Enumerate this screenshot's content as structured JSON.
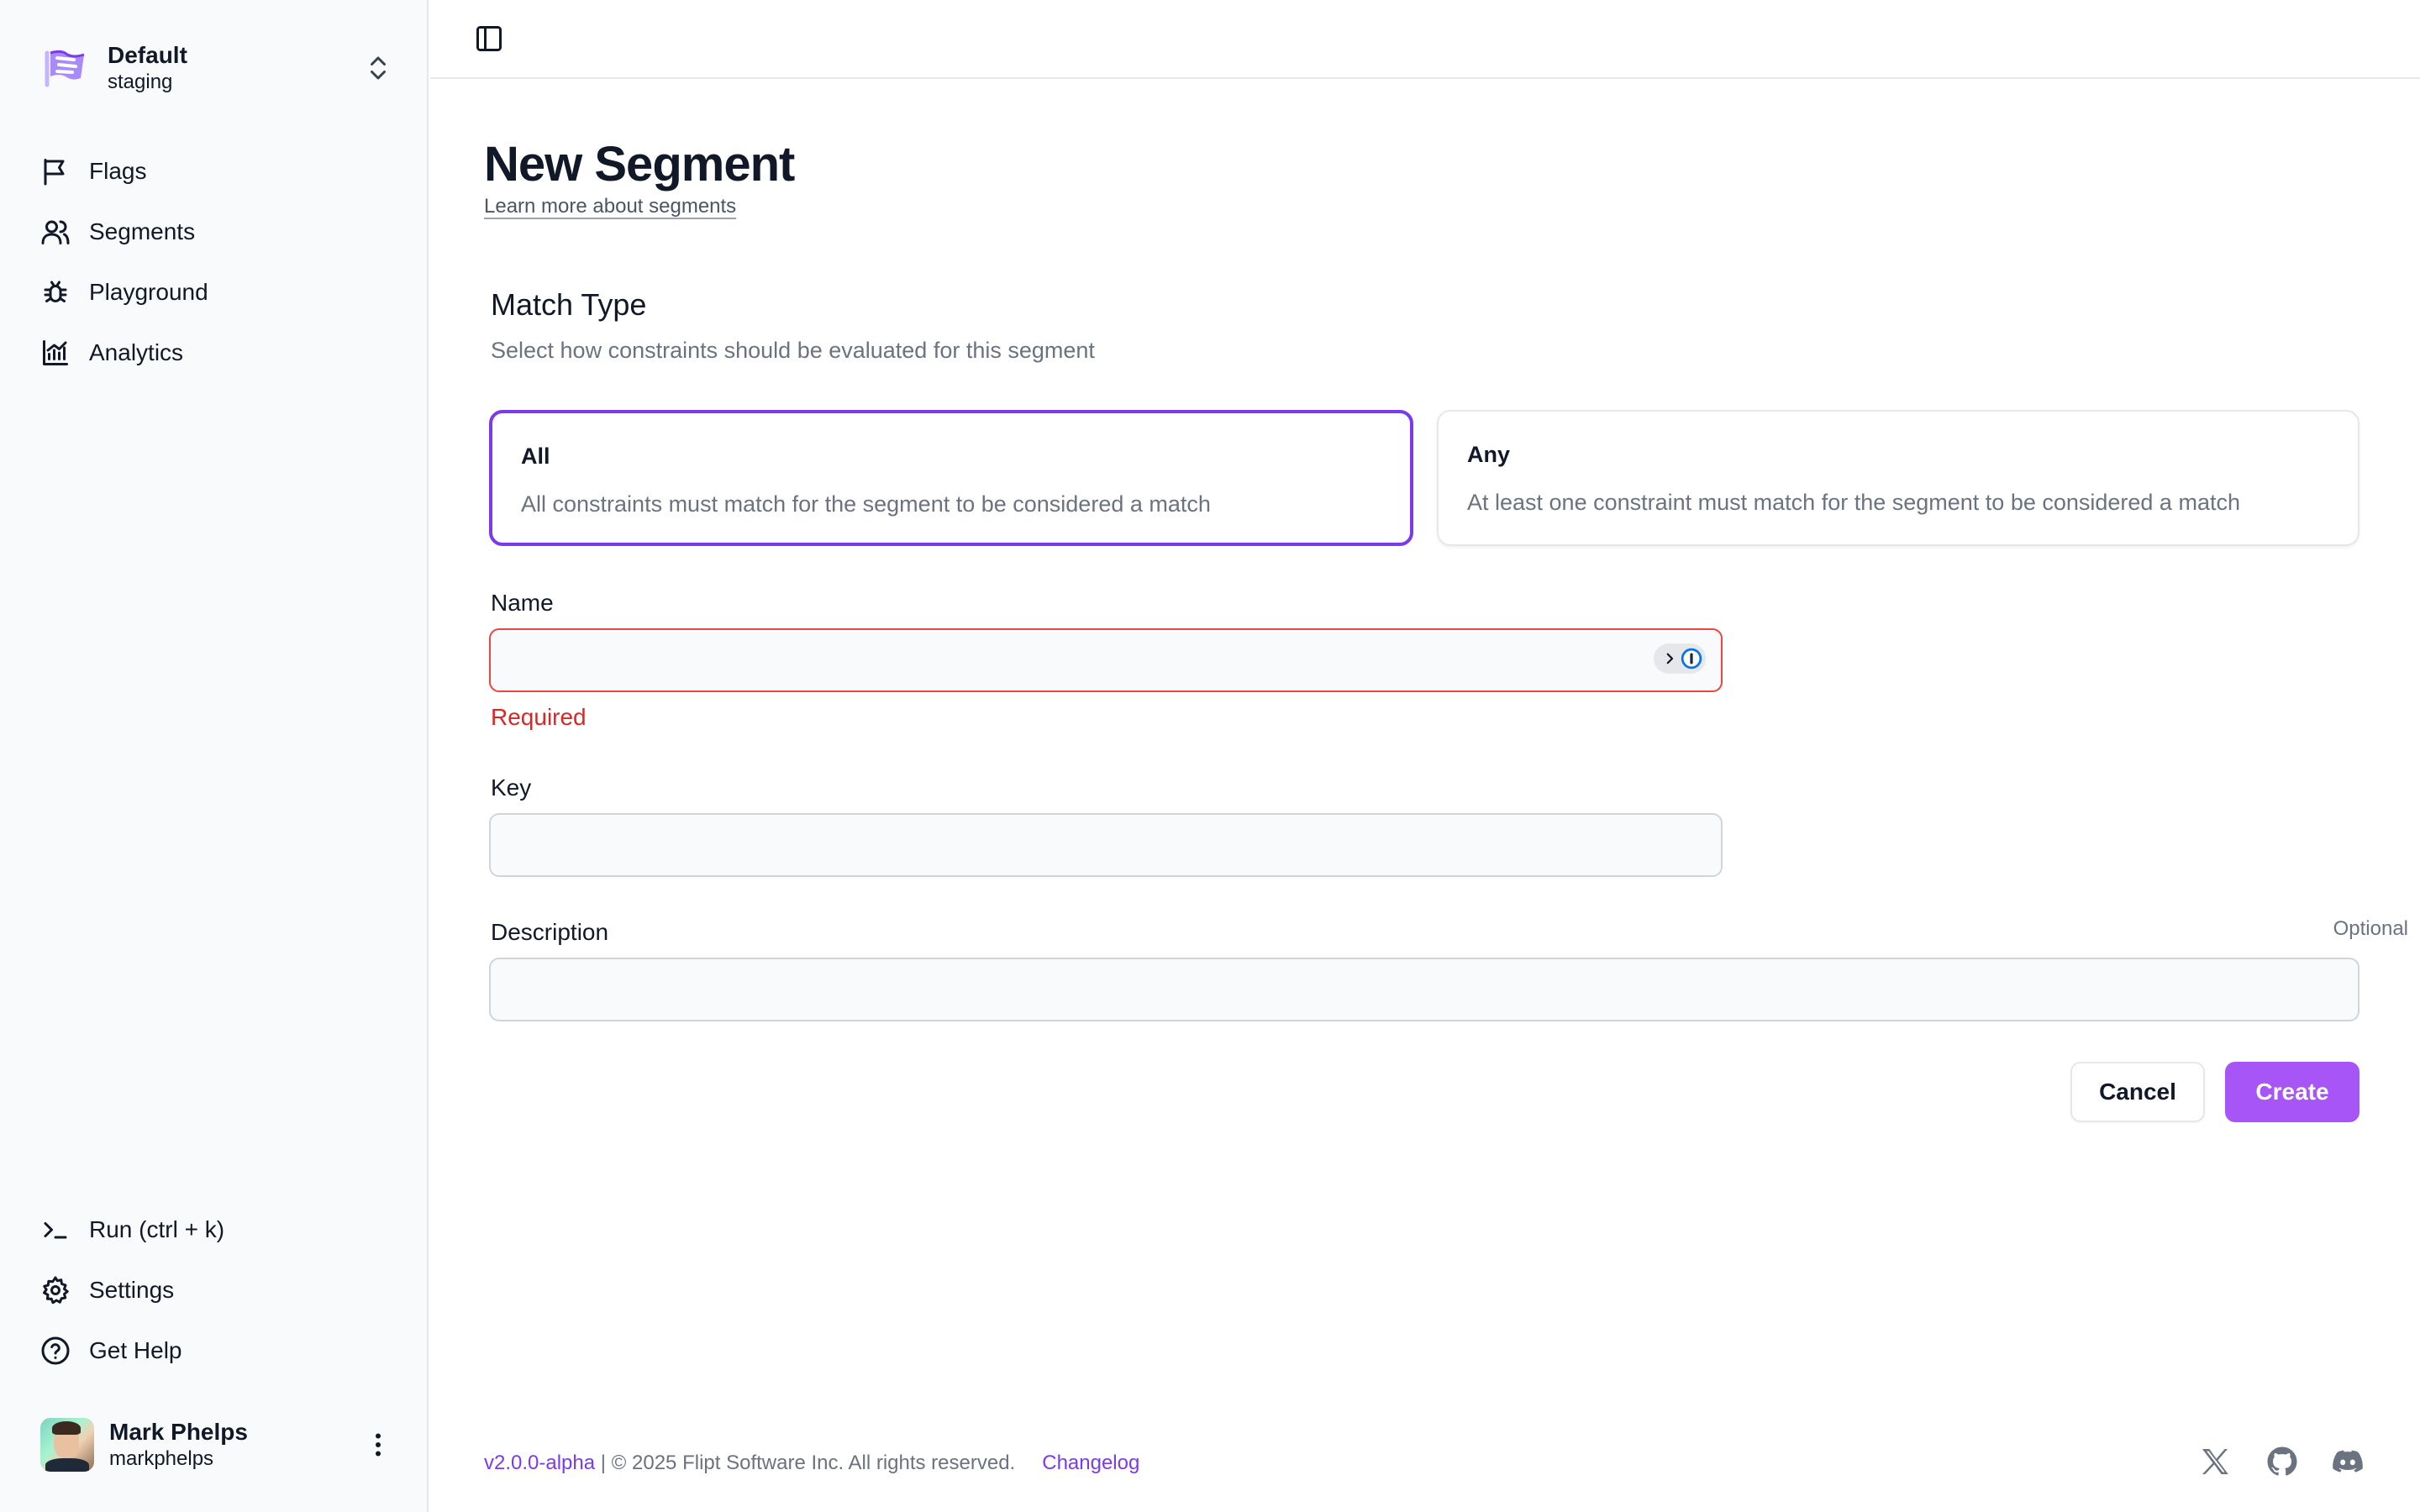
{
  "namespace": {
    "name": "Default",
    "environment": "staging"
  },
  "nav": [
    {
      "label": "Flags",
      "icon": "flag-icon"
    },
    {
      "label": "Segments",
      "icon": "users-icon"
    },
    {
      "label": "Playground",
      "icon": "bug-icon"
    },
    {
      "label": "Analytics",
      "icon": "chart-icon"
    }
  ],
  "nav_bottom": [
    {
      "label": "Run (ctrl + k)",
      "icon": "terminal-icon"
    },
    {
      "label": "Settings",
      "icon": "gear-icon"
    },
    {
      "label": "Get Help",
      "icon": "help-icon"
    }
  ],
  "user": {
    "name": "Mark Phelps",
    "handle": "markphelps"
  },
  "page": {
    "title": "New Segment",
    "learn_more": "Learn more about segments"
  },
  "match_type": {
    "title": "Match Type",
    "description": "Select how constraints should be evaluated for this segment",
    "options": [
      {
        "label": "All",
        "description": "All constraints must match for the segment to be considered a match",
        "selected": true
      },
      {
        "label": "Any",
        "description": "At least one constraint must match for the segment to be considered a match",
        "selected": false
      }
    ]
  },
  "form": {
    "name_label": "Name",
    "name_value": "",
    "name_error": "Required",
    "key_label": "Key",
    "key_value": "",
    "description_label": "Description",
    "description_value": "",
    "optional_label": "Optional"
  },
  "actions": {
    "cancel": "Cancel",
    "create": "Create"
  },
  "footer": {
    "version": "v2.0.0-alpha",
    "copyright": " | © 2025 Flipt Software Inc. All rights reserved.",
    "changelog": "Changelog"
  },
  "colors": {
    "accent": "#7c3aed",
    "create_button": "#a855f7",
    "error": "#dc2626"
  }
}
